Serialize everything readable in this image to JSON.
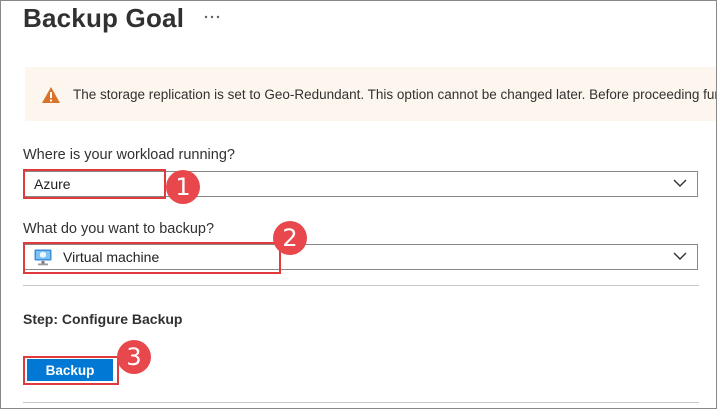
{
  "page": {
    "title": "Backup Goal",
    "more_icon": "ellipsis-icon"
  },
  "warning": {
    "icon": "warning-icon",
    "text": "The storage replication is set to Geo-Redundant. This option cannot be changed later. Before proceeding fur"
  },
  "workload": {
    "label": "Where is your workload running?",
    "selected": "Azure"
  },
  "backup_type": {
    "label": "What do you want to backup?",
    "selected": "Virtual machine",
    "icon": "virtual-machine-icon"
  },
  "step": {
    "title": "Step: Configure Backup",
    "button_label": "Backup"
  },
  "annotations": {
    "step1": "1",
    "step2": "2",
    "step3": "3"
  },
  "colors": {
    "accent": "#0078d4",
    "highlight": "#e0393e",
    "warning_bg": "#fdf6ee",
    "warning_icon": "#d83b01"
  }
}
